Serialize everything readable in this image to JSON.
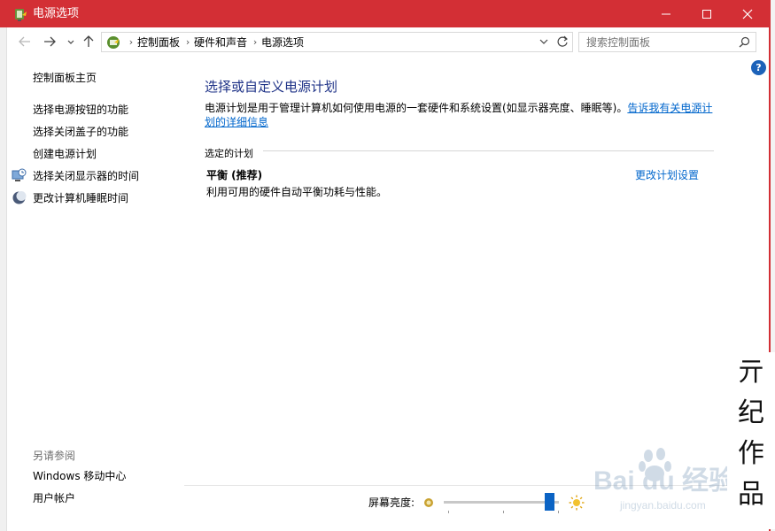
{
  "window": {
    "title": "电源选项",
    "accent_color": "#d32f35"
  },
  "address_bar": {
    "crumbs": [
      "控制面板",
      "硬件和声音",
      "电源选项"
    ],
    "search_placeholder": "搜索控制面板"
  },
  "help": {
    "label": "?"
  },
  "sidebar": {
    "home": "控制面板主页",
    "links": [
      "选择电源按钮的功能",
      "选择关闭盖子的功能",
      "创建电源计划",
      "选择关闭显示器的时间",
      "更改计算机睡眠时间"
    ],
    "see_also_title": "另请参阅",
    "see_also": [
      "Windows 移动中心",
      "用户帐户"
    ]
  },
  "main": {
    "heading": "选择或自定义电源计划",
    "description": "电源计划是用于管理计算机如何使用电源的一套硬件和系统设置(如显示器亮度、睡眠等)。",
    "description_link": "告诉我有关电源计划的详细信息",
    "section_label": "选定的计划",
    "plan_name": "平衡 (推荐)",
    "plan_desc": "利用可用的硬件自动平衡功耗与性能。",
    "plan_change": "更改计划设置"
  },
  "footer": {
    "brightness_label": "屏幕亮度:",
    "brightness_level": 0.92
  },
  "watermark": {
    "chars": [
      "亓",
      "纪",
      "作",
      "品"
    ],
    "baidu_text": "Bai du 经验",
    "baidu_url": "jingyan.baidu.com"
  }
}
